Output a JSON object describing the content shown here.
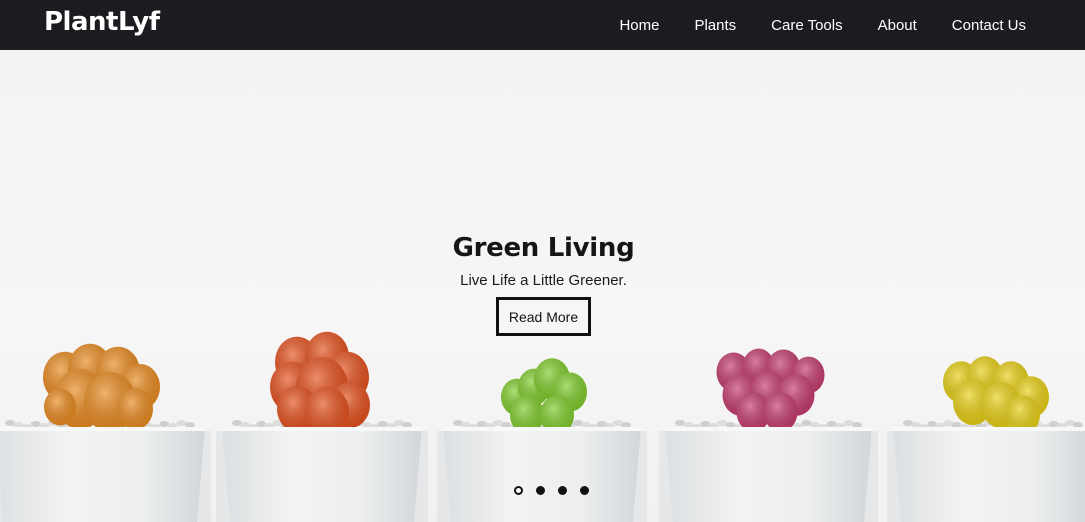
{
  "navbar": {
    "brand": "PlantLyf",
    "links": [
      "Home",
      "Plants",
      "Care Tools",
      "About",
      "Contact Us"
    ]
  },
  "hero": {
    "title": "Green Living",
    "subtitle": "Live Life a Little Greener.",
    "button_label": "Read More",
    "slide_count": 4,
    "active_slide": 1,
    "cactus_colors": [
      "#e98a1f",
      "#e4501d",
      "#7fcc2c",
      "#c43b6e",
      "#e8cf15"
    ]
  },
  "colors": {
    "navbar_bg": "#1b1c1f",
    "hero_bg": "#f4f4f4",
    "pot": "#eceeef"
  }
}
